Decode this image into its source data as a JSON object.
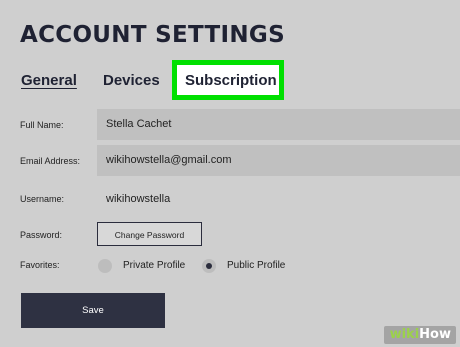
{
  "page": {
    "title": "ACCOUNT SETTINGS"
  },
  "tabs": [
    {
      "label": "General",
      "active": true
    },
    {
      "label": "Devices"
    },
    {
      "label": "Subscription",
      "highlighted": true
    }
  ],
  "form": {
    "full_name": {
      "label": "Full Name:",
      "value": "Stella Cachet"
    },
    "email": {
      "label": "Email Address:",
      "value": "wikihowstella@gmail.com"
    },
    "username": {
      "label": "Username:",
      "value": "wikihowstella"
    },
    "password": {
      "label": "Password:",
      "button_label": "Change Password"
    },
    "favorites": {
      "label": "Favorites:",
      "options": [
        {
          "label": "Private Profile",
          "selected": false
        },
        {
          "label": "Public Profile",
          "selected": true
        }
      ]
    }
  },
  "actions": {
    "save_label": "Save"
  },
  "watermark": {
    "part1": "wiki",
    "part2": "How"
  },
  "colors": {
    "highlight": "#00e000",
    "save_button_bg": "#2e3142",
    "background": "#cfcfcf",
    "field_bg": "#c0c0c0"
  }
}
